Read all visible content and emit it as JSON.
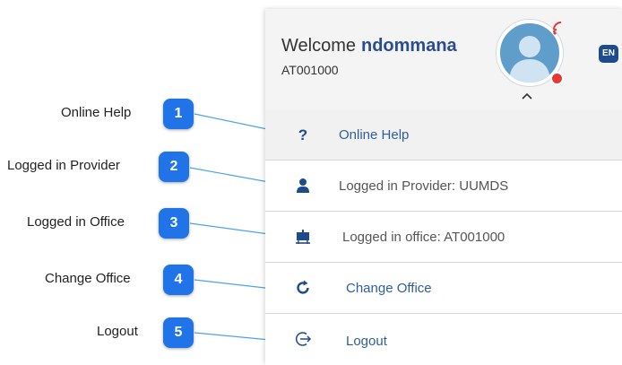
{
  "header": {
    "welcome_text": "Welcome",
    "username": "ndommana",
    "user_id": "AT001000",
    "language_label": "EN"
  },
  "menu": [
    {
      "label": "Online Help",
      "icon": "question-mark-icon",
      "link": true
    },
    {
      "label": "Logged in Provider: UUMDS",
      "icon": "person-icon",
      "link": false
    },
    {
      "label": "Logged in office: AT001000",
      "icon": "office-icon",
      "link": false
    },
    {
      "label": "Change Office",
      "icon": "refresh-icon",
      "link": true
    },
    {
      "label": "Logout",
      "icon": "logout-icon",
      "link": true
    }
  ],
  "callouts": [
    {
      "number": "1",
      "label": "Online Help"
    },
    {
      "number": "2",
      "label": "Logged in Provider"
    },
    {
      "number": "3",
      "label": "Logged in Office"
    },
    {
      "number": "4",
      "label": "Change Office"
    },
    {
      "number": "5",
      "label": "Logout"
    }
  ],
  "colors": {
    "badge": "#2074e8",
    "link": "#2f5e9e",
    "icon": "#1e4b8c",
    "status_dot": "#e53935"
  }
}
